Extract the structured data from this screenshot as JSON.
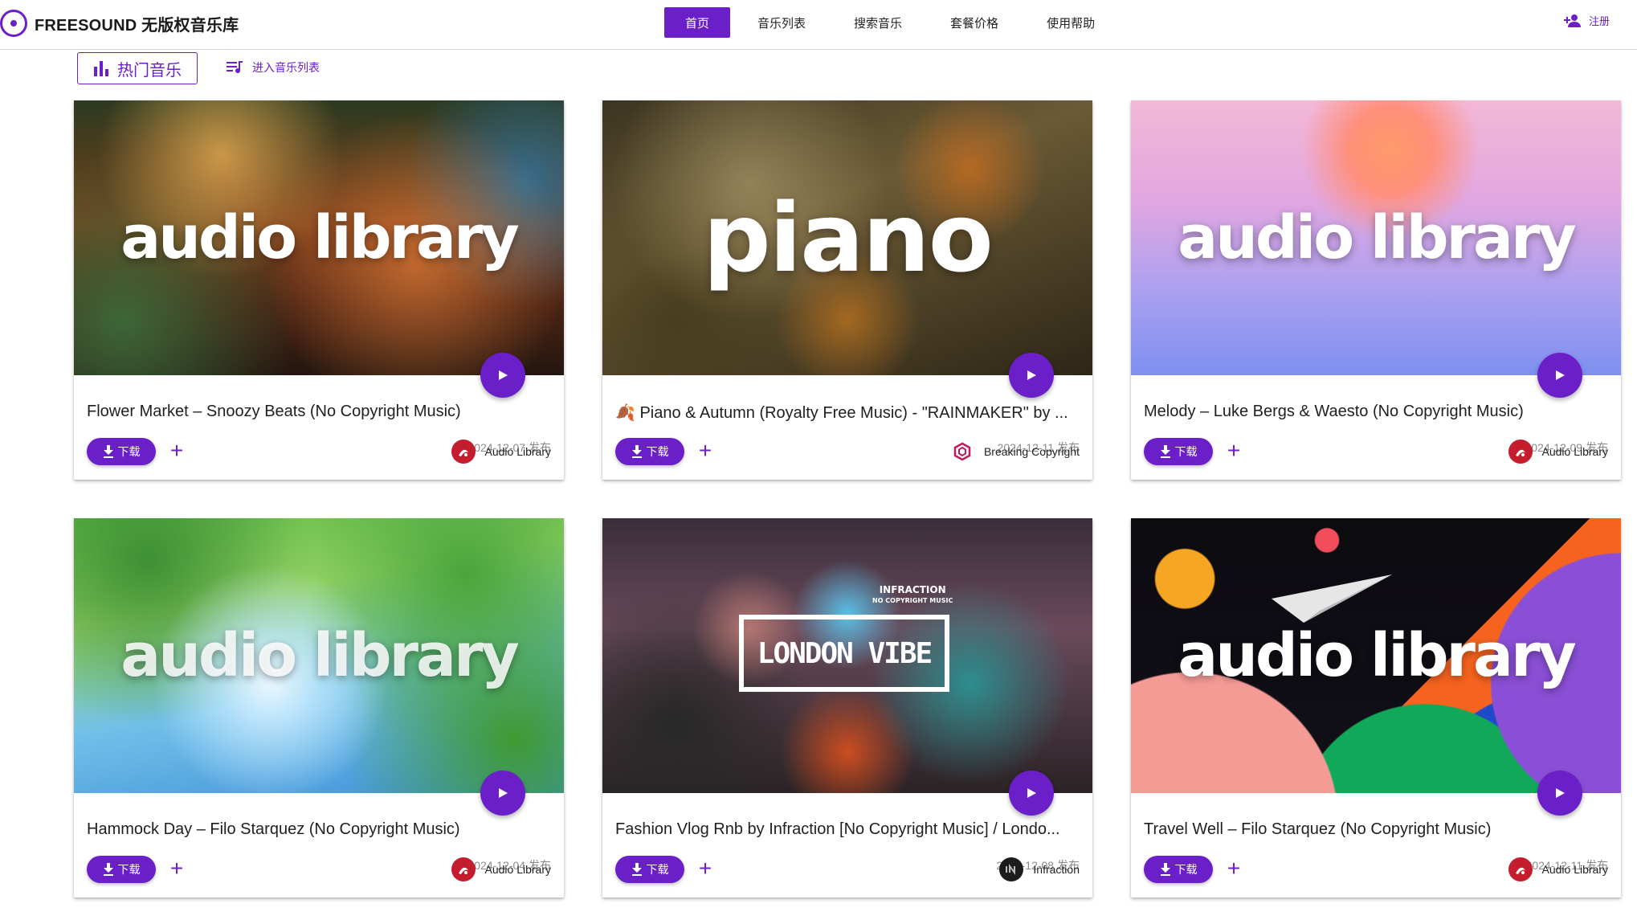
{
  "brand": {
    "name": "FREESOUND 无版权音乐库"
  },
  "nav": {
    "items": [
      "首页",
      "音乐列表",
      "搜索音乐",
      "套餐价格",
      "使用帮助"
    ],
    "active_index": 0,
    "register_label": "注册"
  },
  "toolbar": {
    "hot_label": "热门音乐",
    "list_link_label": "进入音乐列表"
  },
  "colors": {
    "accent": "#6a1fc9",
    "date": "#8a8a8a"
  },
  "cards": [
    {
      "thumb_text": "audio library",
      "title": "Flower Market – Snoozy Beats (No Copyright Music)",
      "date": "2024-12-07 发布",
      "download_label": "下载",
      "author": "Audio Library",
      "author_icon": "audio-library-logo"
    },
    {
      "thumb_text": "piano",
      "title": "🍂 Piano & Autumn (Royalty Free Music) - \"RAINMAKER\" by ...",
      "date": "2024-12-11 发布",
      "download_label": "下载",
      "author": "Breaking Copyright",
      "author_icon": "breaking-copyright-logo"
    },
    {
      "thumb_text": "audio library",
      "title": "Melody – Luke Bergs & Waesto (No Copyright Music)",
      "date": "2024-12-09 发布",
      "download_label": "下载",
      "author": "Audio Library",
      "author_icon": "audio-library-logo"
    },
    {
      "thumb_text": "audio library",
      "title": "Hammock Day – Filo Starquez (No Copyright Music)",
      "date": "2024-12-04 发布",
      "download_label": "下载",
      "author": "Audio Library",
      "author_icon": "audio-library-logo"
    },
    {
      "thumb_text": "LONDON VIBE",
      "thumb_tag": "INFRACTION",
      "thumb_tag2": "NO COPYRIGHT MUSIC",
      "title": "Fashion Vlog Rnb by Infraction [No Copyright Music] / Londo...",
      "date": "2024-12-08 发布",
      "download_label": "下载",
      "author": "Infraction",
      "author_icon": "infraction-logo"
    },
    {
      "thumb_text": "audio library",
      "title": "Travel Well – Filo Starquez (No Copyright Music)",
      "date": "2024-12-11 发布",
      "download_label": "下载",
      "author": "Audio Library",
      "author_icon": "audio-library-logo"
    }
  ]
}
